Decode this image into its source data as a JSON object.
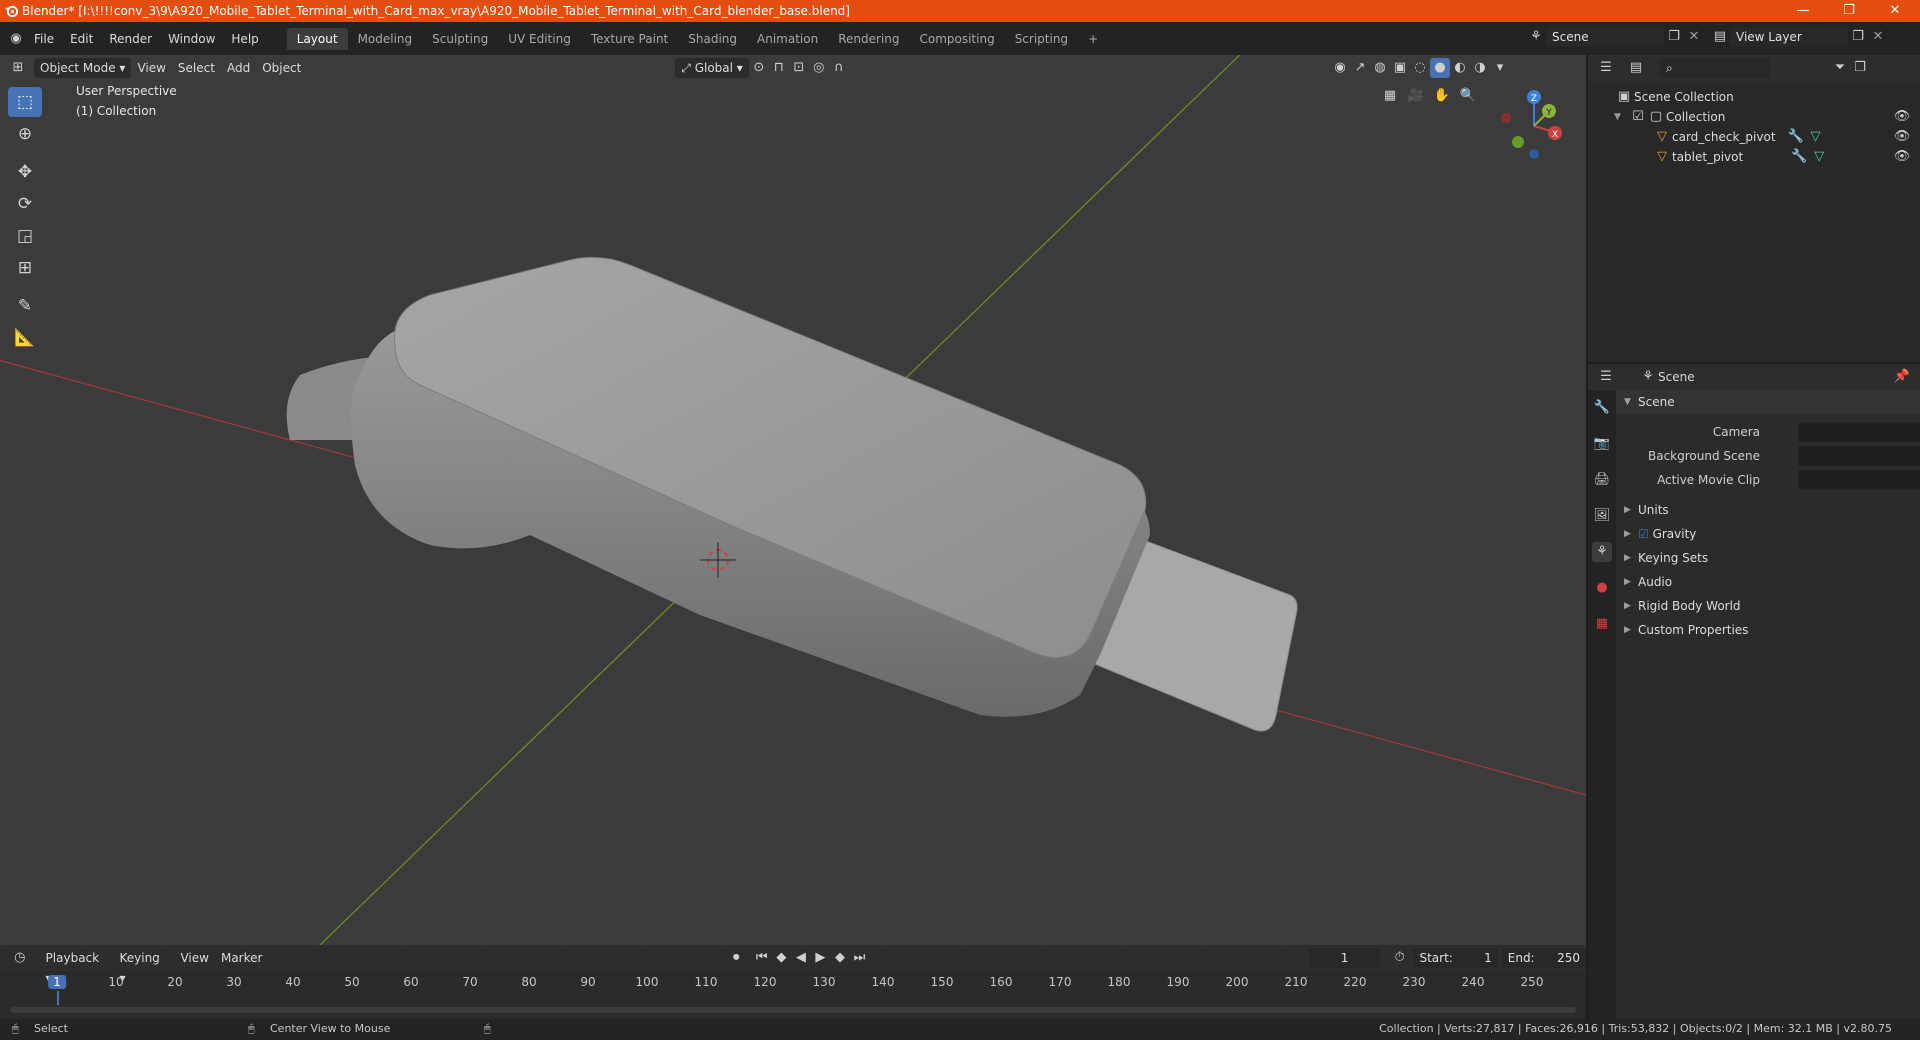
{
  "title_bar": {
    "title": "Blender* [I:\\!!!!conv_3\\9\\A920_Mobile_Tablet_Terminal_with_Card_max_vray\\A920_Mobile_Tablet_Terminal_with_Card_blender_base.blend]",
    "minimize": "—",
    "maximize": "❐",
    "close": "✕"
  },
  "menu": [
    "File",
    "Edit",
    "Render",
    "Window",
    "Help"
  ],
  "workspaces": [
    "Layout",
    "Modeling",
    "Sculpting",
    "UV Editing",
    "Texture Paint",
    "Shading",
    "Animation",
    "Rendering",
    "Compositing",
    "Scripting"
  ],
  "workspace_add": "+",
  "scene_field": "Scene",
  "view_layer_field": "View Layer",
  "viewport_header": {
    "mode": "Object Mode",
    "menus": [
      "View",
      "Select",
      "Add",
      "Object"
    ],
    "transform_orientation": "Global"
  },
  "overlay_text": {
    "perspective": "User Perspective",
    "collection": "(1) Collection"
  },
  "gizmo": {
    "x": "X",
    "y": "Y",
    "z": "Z"
  },
  "outliner": {
    "root": "Scene Collection",
    "collection": "Collection",
    "objects": [
      "card_check_pivot",
      "tablet_pivot"
    ]
  },
  "properties": {
    "header": "Scene",
    "panel": "Scene",
    "camera_label": "Camera",
    "background_scene_label": "Background Scene",
    "active_movie_clip_label": "Active Movie Clip",
    "sections": [
      "Units",
      "Gravity",
      "Keying Sets",
      "Audio",
      "Rigid Body World",
      "Custom Properties"
    ]
  },
  "timeline": {
    "menus": [
      "Playback",
      "Keying",
      "View",
      "Marker"
    ],
    "current_frame": "1",
    "start_label": "Start:",
    "start": "1",
    "end_label": "End:",
    "end": "250",
    "ticks": [
      "1",
      "10",
      "20",
      "30",
      "40",
      "50",
      "60",
      "70",
      "80",
      "90",
      "100",
      "110",
      "120",
      "130",
      "140",
      "150",
      "160",
      "170",
      "180",
      "190",
      "200",
      "210",
      "220",
      "230",
      "240",
      "250"
    ]
  },
  "status_bar": {
    "left": "Select",
    "middle": "Center View to Mouse",
    "right": "Collection | Verts:27,817 | Faces:26,916 | Tris:53,832 | Objects:0/2 | Mem: 32.1 MB | v2.80.75"
  },
  "colors": {
    "title_bar": "#e44d10",
    "accent": "#4772b3",
    "x_axis": "#d0403c",
    "y_axis": "#8ab33c",
    "z_axis": "#3f7fd8"
  }
}
